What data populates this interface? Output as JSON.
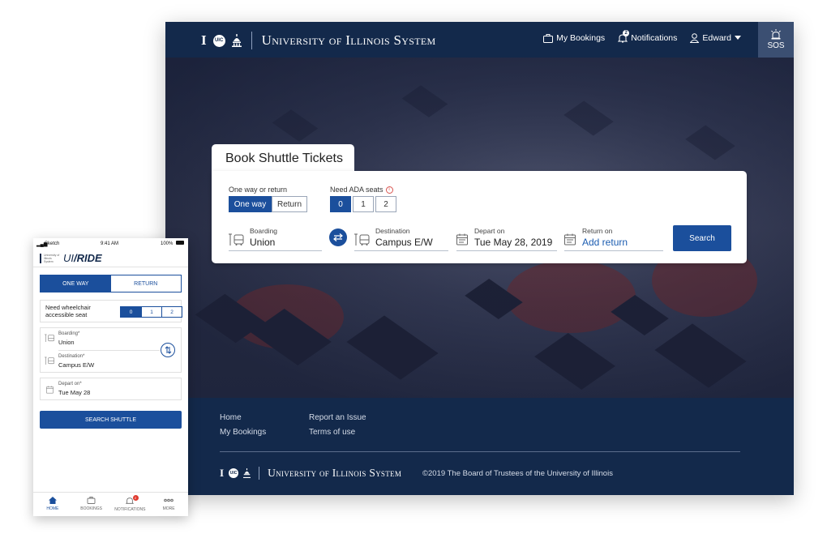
{
  "desktop": {
    "header": {
      "logo_i": "I",
      "logo_uic": "UIC",
      "system_name": "University of Illinois System",
      "nav": {
        "bookings": "My Bookings",
        "notifications": "Notifications",
        "notifications_count": "2",
        "user": "Edward"
      },
      "sos": "SOS",
      "icons": [
        "briefcase-icon",
        "bell-icon",
        "user-icon",
        "caret-down-icon",
        "alarm-icon"
      ]
    },
    "booking": {
      "title": "Book Shuttle Tickets",
      "trip_type_label": "One way or return",
      "trip_types": [
        "One way",
        "Return"
      ],
      "trip_type_selected": "One way",
      "ada_label": "Need ADA seats",
      "ada_options": [
        "0",
        "1",
        "2"
      ],
      "ada_selected": "0",
      "boarding_label": "Boarding",
      "boarding_value": "Union",
      "destination_label": "Destination",
      "destination_value": "Campus E/W",
      "depart_label": "Depart on",
      "depart_value": "Tue May 28, 2019",
      "return_label": "Return on",
      "return_value": "Add return",
      "search_label": "Search"
    },
    "footer": {
      "links": [
        "Home",
        "My Bookings",
        "Report an Issue",
        "Terms of use"
      ],
      "system_name": "University of Illinois System",
      "copyright": "©2019 The Board of Trustees of the University of Illinois"
    }
  },
  "phone": {
    "status": {
      "carrier": "Sketch",
      "time": "9:41 AM",
      "battery": "100%"
    },
    "logo_text": "University of Illinois System",
    "app_name_a": "UI",
    "app_name_b": "RIDE",
    "trip_types": [
      "ONE WAY",
      "RETURN"
    ],
    "trip_type_selected": "ONE WAY",
    "wheelchair_label_1": "Need wheelchair",
    "wheelchair_label_2": "accessible seat",
    "ada_options": [
      "0",
      "1",
      "2"
    ],
    "ada_selected": "0",
    "boarding_label": "Boarding*",
    "boarding_value": "Union",
    "destination_label": "Destination*",
    "destination_value": "Campus E/W",
    "depart_label": "Depart on*",
    "depart_value": "Tue May 28",
    "search_label": "SEARCH SHUTTLE",
    "tabs": [
      {
        "label": "HOME",
        "icon": "home-icon"
      },
      {
        "label": "BOOKINGS",
        "icon": "briefcase-icon"
      },
      {
        "label": "NOTIFICATIONS",
        "icon": "bell-icon",
        "badge": "2"
      },
      {
        "label": "MORE",
        "icon": "more-icon"
      }
    ]
  },
  "colors": {
    "navy": "#13294b",
    "accent": "#1b4f9c",
    "link": "#1b5cb0",
    "badge": "#e03a2f"
  }
}
